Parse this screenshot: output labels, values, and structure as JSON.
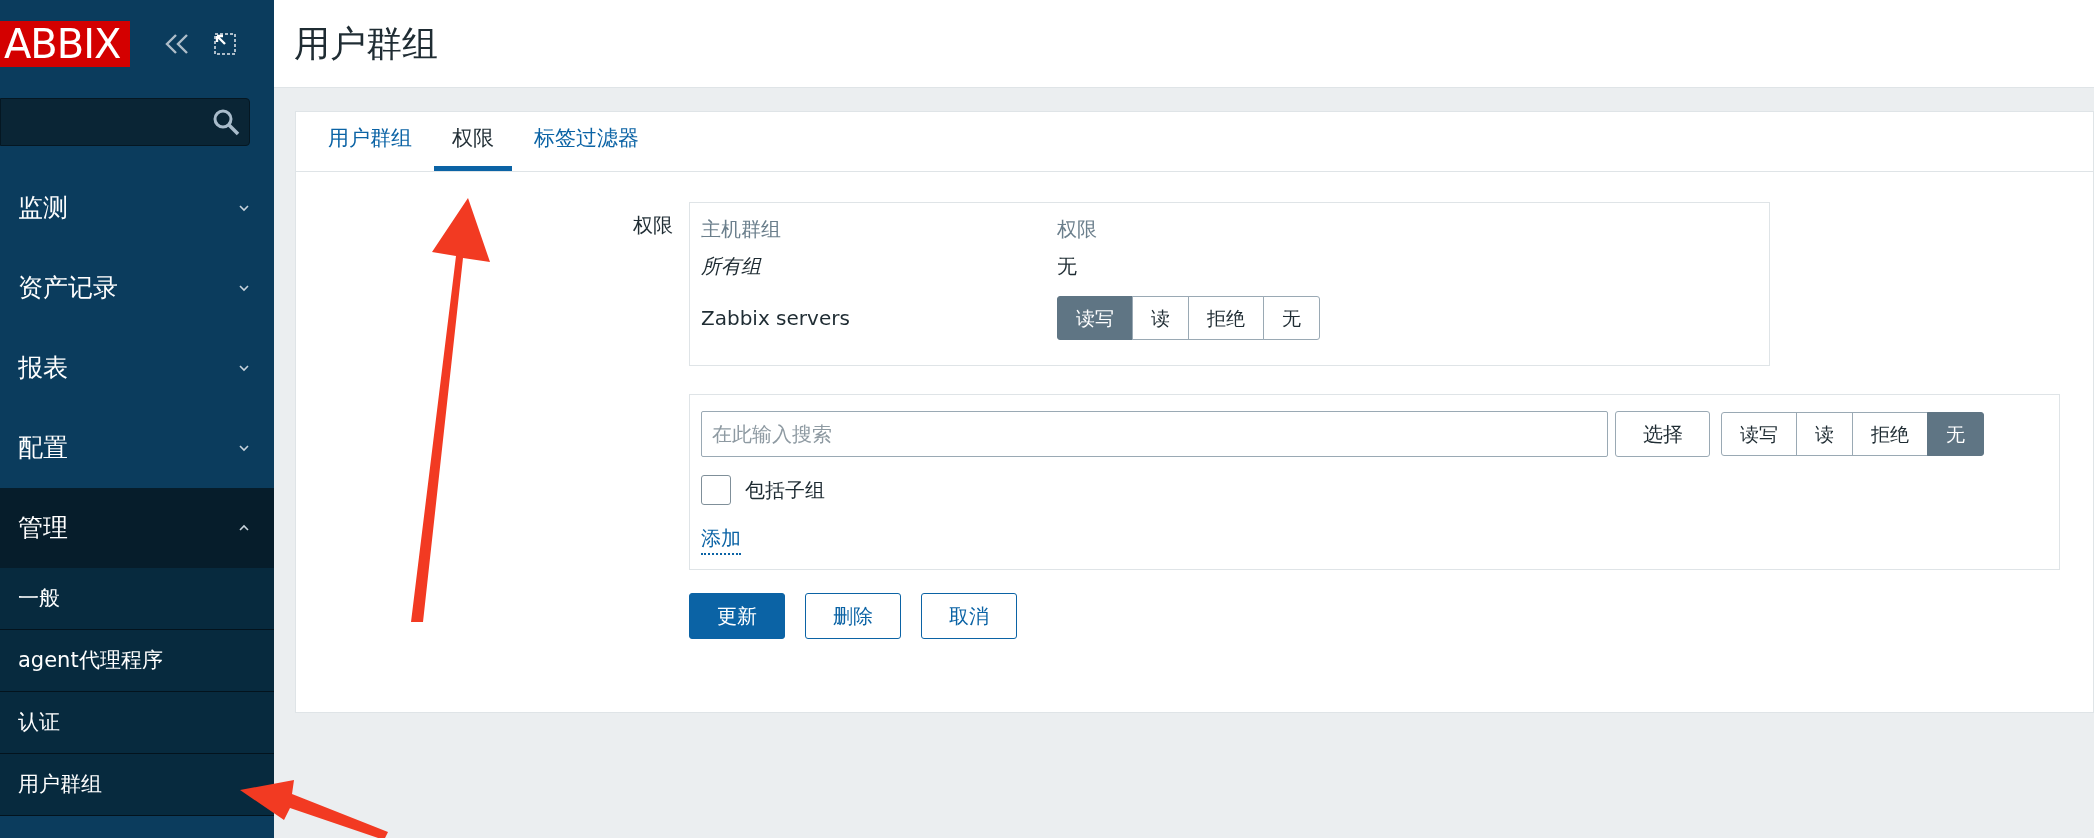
{
  "sidebar": {
    "logo": "ABBIX",
    "menu": [
      {
        "label": "监测",
        "expanded": false
      },
      {
        "label": "资产记录",
        "expanded": false
      },
      {
        "label": "报表",
        "expanded": false
      },
      {
        "label": "配置",
        "expanded": false
      },
      {
        "label": "管理",
        "expanded": true,
        "children": [
          {
            "label": "一般"
          },
          {
            "label": "agent代理程序"
          },
          {
            "label": "认证"
          },
          {
            "label": "用户群组"
          }
        ]
      }
    ]
  },
  "page": {
    "title": "用户群组"
  },
  "tabs": [
    {
      "label": "用户群组",
      "selected": false
    },
    {
      "label": "权限",
      "selected": true
    },
    {
      "label": "标签过滤器",
      "selected": false
    }
  ],
  "form": {
    "label": "权限",
    "table": {
      "columns": [
        "主机群组",
        "权限"
      ],
      "rows": [
        {
          "kind": "all",
          "group": "所有组",
          "permission": "无"
        },
        {
          "kind": "group",
          "group": "Zabbix servers",
          "options": [
            {
              "label": "读写",
              "selected": true
            },
            {
              "label": "读",
              "selected": false
            },
            {
              "label": "拒绝",
              "selected": false
            },
            {
              "label": "无",
              "selected": false
            }
          ]
        }
      ]
    },
    "add_box": {
      "placeholder": "在此输入搜索",
      "select_button": "选择",
      "options": [
        {
          "label": "读写",
          "selected": false
        },
        {
          "label": "读",
          "selected": false
        },
        {
          "label": "拒绝",
          "selected": false
        },
        {
          "label": "无",
          "selected": true
        }
      ],
      "include_subgroups": {
        "label": "包括子组",
        "checked": false
      },
      "add_link": "添加"
    },
    "buttons": [
      {
        "label": "更新",
        "kind": "primary"
      },
      {
        "label": "删除",
        "kind": "secondary"
      },
      {
        "label": "取消",
        "kind": "secondary"
      }
    ]
  }
}
